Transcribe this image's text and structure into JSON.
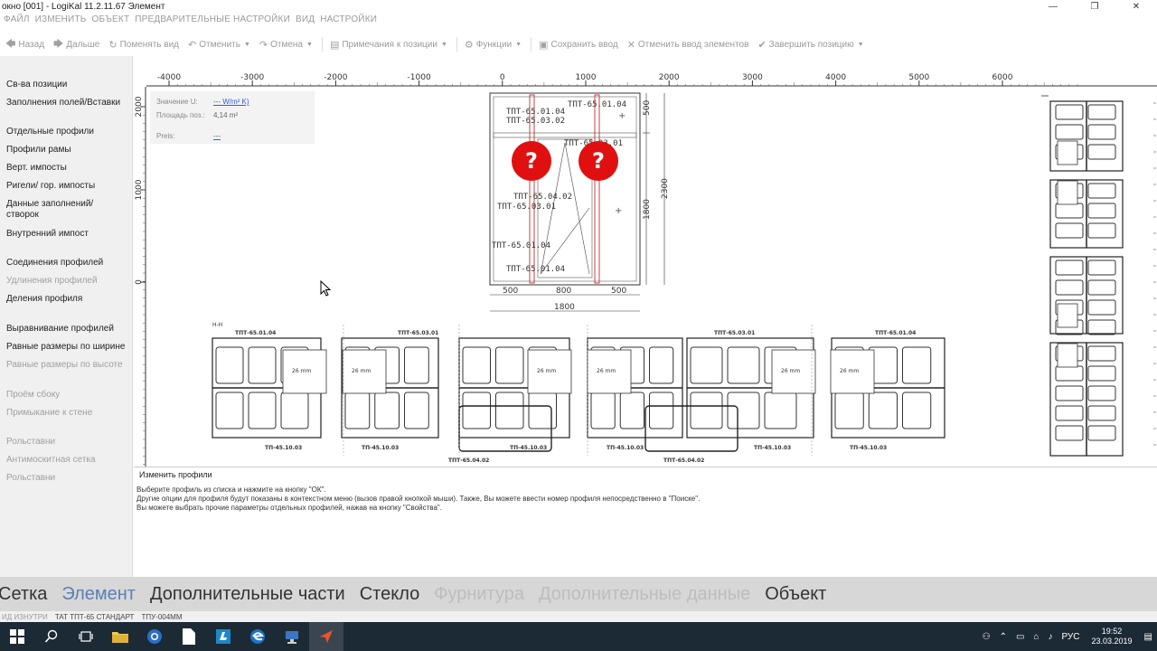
{
  "window": {
    "title": "окно [001] - LogiKal 11.2.11.67 Элемент",
    "minimize": "—",
    "maximize": "❐",
    "close": "✕"
  },
  "menu": [
    "ФАЙЛ",
    "ИЗМЕНИТЬ",
    "ОБЪЕКТ",
    "ПРЕДВАРИТЕЛЬНЫЕ НАСТРОЙКИ",
    "ВИД",
    "НАСТРОЙКИ"
  ],
  "toolbar": {
    "back": "Назад",
    "forward": "Дальше",
    "change_view": "Поменять вид",
    "undo": "Отменить",
    "redo": "Отмена",
    "position_notes": "Примечания к позиции",
    "functions": "Функции",
    "save_input": "Сохранить ввод",
    "cancel_input": "Отменить ввод элементов",
    "finish_position": "Завершить позицию"
  },
  "sidebar": [
    {
      "label": "Св-ва позиции",
      "enabled": true
    },
    {
      "label": "Заполнения полей/Вставки",
      "enabled": true
    },
    {
      "label": "Отдельные профили",
      "enabled": true
    },
    {
      "label": "Профили рамы",
      "enabled": true
    },
    {
      "label": "Верт. импосты",
      "enabled": true
    },
    {
      "label": "Ригели/ гор. импосты",
      "enabled": true
    },
    {
      "label": "Данные заполнений/створок",
      "enabled": true
    },
    {
      "label": "Внутренний импост",
      "enabled": true
    },
    {
      "label": "Соединения профилей",
      "enabled": true
    },
    {
      "label": "Удлинения профилей",
      "enabled": false
    },
    {
      "label": "Деления профиля",
      "enabled": true
    },
    {
      "label": "Выравнивание профилей",
      "enabled": true
    },
    {
      "label": "Равные размеры по ширине",
      "enabled": true
    },
    {
      "label": "Равные размеры по высоте",
      "enabled": false
    },
    {
      "label": "Проём сбоку",
      "enabled": false
    },
    {
      "label": "Примыкание к стене",
      "enabled": false
    },
    {
      "label": "Рольставни",
      "enabled": false
    },
    {
      "label": "Антимоскитная сетка",
      "enabled": false
    },
    {
      "label": "Рольставни",
      "enabled": false
    }
  ],
  "ruler": {
    "top_ticks": [
      "-4000",
      "-3000",
      "-2000",
      "-1000",
      "0",
      "1000",
      "2000",
      "3000",
      "4000",
      "5000",
      "6000"
    ],
    "left_ticks": [
      "2000",
      "1000",
      "0"
    ]
  },
  "infobox": {
    "u_label": "Значение U:",
    "u_value": "--- W/m² K)",
    "area_label": "Площадь поз.:",
    "area_value": "4,14 m²",
    "price_label": "Preis:",
    "price_value": "---"
  },
  "drawing": {
    "profiles": [
      "ТПТ-65.01.04",
      "ТПТ-65.03.02",
      "ТПТ-65.01.04",
      "ТПТ-65.03.01",
      "ТПТ-65.04.02",
      "ТПТ-65.03.01",
      "ТПТ-65.01.04",
      "ТПТ-65.01.04"
    ],
    "dims_bottom": [
      "500",
      "800",
      "500"
    ],
    "dim_total": "1800",
    "dims_right": [
      "500",
      "1800"
    ],
    "dim_height": "2300",
    "question": "?"
  },
  "section": {
    "label": "Н-Н",
    "top_labels": [
      "ТПТ-65.01.04",
      "ТПТ-65.03.01",
      "ТПТ-65.03.01",
      "ТПТ-65.01.04"
    ],
    "glass_labels": [
      "26 mm",
      "26 mm",
      "26 mm",
      "26 mm",
      "26 mm",
      "26 mm"
    ],
    "bottom_labels": [
      "ТП-45.10.03",
      "ТП-45.10.03",
      "ТП-45.10.03",
      "ТП-45.10.03",
      "ТП-45.10.03",
      "ТП-45.10.03"
    ],
    "mullion_labels": [
      "ТПТ-65.04.02",
      "ТПТ-65.04.02"
    ]
  },
  "message": {
    "title": "Изменить профили",
    "lines": [
      "Выберите профиль из списка и нажмите на кнопку \"ОК\".",
      "Другие опции для профиля будут показаны в контекстном меню (вызов правой кнопкой мыши). Также, Вы можете ввести номер профиля непосредственно в \"Поиске\".",
      "Вы можете выбрать прочие параметры отдельных профилей, нажав на кнопку \"Свойства\"."
    ]
  },
  "tabs": [
    {
      "label": "Сетка",
      "state": "normal"
    },
    {
      "label": "Элемент",
      "state": "active"
    },
    {
      "label": "Дополнительные части",
      "state": "normal"
    },
    {
      "label": "Стекло",
      "state": "normal"
    },
    {
      "label": "Фурнитура",
      "state": "disabled"
    },
    {
      "label": "Дополнительные данные",
      "state": "disabled"
    },
    {
      "label": "Объект",
      "state": "normal"
    }
  ],
  "status": {
    "left": "ИД ИЗНУТРИ",
    "series": "ТАТ ТПТ-65 СТАНДАРТ",
    "code": "ТПУ-004ММ"
  },
  "taskbar": {
    "lang": "РУС",
    "time": "19:52",
    "date": "23.03.2019"
  },
  "colors": {
    "accent_tab": "#5b7fb3",
    "question_badge": "#e01010",
    "taskbar": "#1c2a36"
  }
}
